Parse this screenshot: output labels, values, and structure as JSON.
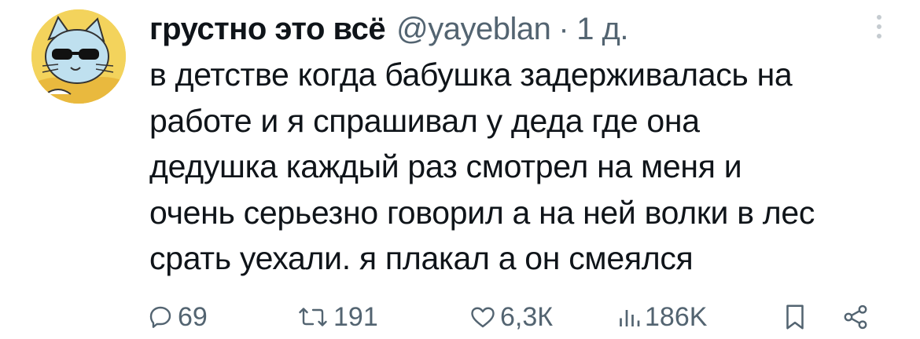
{
  "tweet": {
    "display_name": "грустно это всё",
    "handle": "@yayeblan",
    "separator": "·",
    "time": "1 д.",
    "text_lines": [
      "в детстве когда бабушка задерживалась на",
      "работе и я спрашивал у деда где она",
      "дедушка каждый раз смотрел на меня и",
      "очень серьезно говорил а на ней волки в лес",
      "срать уехали. я плакал а он смеялся"
    ]
  },
  "actions": {
    "replies": "69",
    "retweets": "191",
    "likes": "6,3К",
    "views": "186K"
  },
  "icons": {
    "more": "more-vertical-icon",
    "reply": "reply-icon",
    "retweet": "retweet-icon",
    "like": "heart-icon",
    "views": "views-icon",
    "bookmark": "bookmark-icon",
    "share": "share-icon"
  },
  "colors": {
    "text": "#0f1419",
    "secondary": "#536471",
    "avatar_background": "#f3d35c"
  }
}
